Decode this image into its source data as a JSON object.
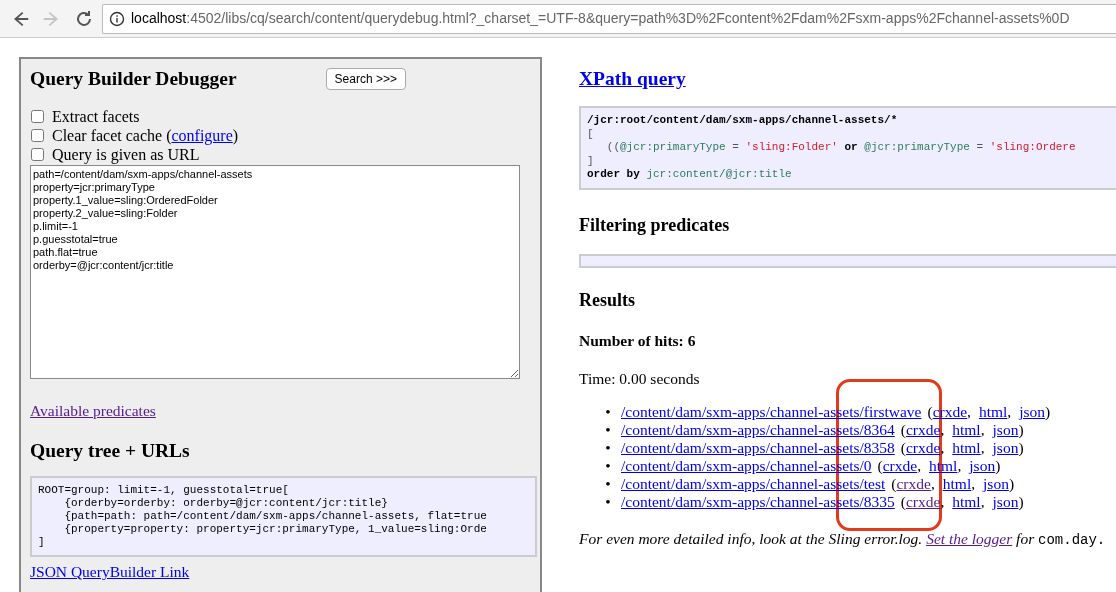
{
  "browser": {
    "back": {
      "disabled": false
    },
    "forward": {
      "disabled": true
    },
    "url_host": "localhost",
    "url_rest": ":4502/libs/cq/search/content/querydebug.html?_charset_=UTF-8&query=path%3D%2Fcontent%2Fdam%2Fsxm-apps%2Fchannel-assets%0D"
  },
  "left_panel": {
    "title": "Query Builder Debugger",
    "search_button": "Search >>>",
    "options": [
      {
        "label": "Extract facets",
        "checked": false
      },
      {
        "label": "Clear facet cache (",
        "link": "configure",
        "after": ")",
        "checked": false
      },
      {
        "label": "Query is given as URL",
        "checked": false
      }
    ],
    "query_text": "path=/content/dam/sxm-apps/channel-assets\nproperty=jcr:primaryType\nproperty.1_value=sling:OrderedFolder\nproperty.2_value=sling:Folder\np.limit=-1\np.guesstotal=true\npath.flat=true\norderby=@jcr:content/jcr:title",
    "predicates_link": {
      "text": "Available predicates",
      "visited": true
    },
    "tree_title": "Query tree + URLs",
    "tree_lines": [
      "ROOT=group: limit=-1, guesstotal=true[",
      "    {orderby=orderby: orderby=@jcr:content/jcr:title}",
      "    {path=path: path=/content/dam/sxm-apps/channel-assets, flat=true",
      "    {property=property: property=jcr:primaryType, 1_value=sling:Orde",
      "]"
    ],
    "json_link": {
      "text": "JSON QueryBuilder Link",
      "visited": false
    }
  },
  "right": {
    "xpath_title": "XPath query",
    "xpath_lines": [
      [
        {
          "kind": "keyword",
          "text": "/jcr:root/content/dam/sxm-apps/channel-assets/*"
        }
      ],
      [
        {
          "kind": "punct",
          "text": "["
        }
      ],
      [
        {
          "kind": "punct",
          "text": "   (("
        },
        {
          "kind": "attr",
          "text": "@jcr:primaryType"
        },
        {
          "kind": "punct",
          "text": " = "
        },
        {
          "kind": "string",
          "text": "'sling:Folder'"
        },
        {
          "kind": "keyword",
          "text": " or "
        },
        {
          "kind": "attr",
          "text": "@jcr:primaryType"
        },
        {
          "kind": "punct",
          "text": " = "
        },
        {
          "kind": "string",
          "text": "'sling:Ordere"
        }
      ],
      [
        {
          "kind": "punct",
          "text": "]"
        }
      ],
      [
        {
          "kind": "keyword",
          "text": "order by"
        },
        {
          "kind": "attr",
          "text": " jcr:content/@jcr:title"
        }
      ]
    ],
    "filter_title": "Filtering predicates",
    "results_title": "Results",
    "hits": "Number of hits: 6",
    "time": "Time: 0.00 seconds",
    "bullet": "•",
    "open_paren": "(",
    "separator": ",",
    "close_paren": ")",
    "results": [
      {
        "path": "/content/dam/sxm-apps/channel-assets/firstwave",
        "links": [
          {
            "text": "crxde",
            "visited": false
          },
          {
            "text": "html",
            "visited": false
          },
          {
            "text": "json",
            "visited": false
          }
        ]
      },
      {
        "path": "/content/dam/sxm-apps/channel-assets/8364",
        "links": [
          {
            "text": "crxde",
            "visited": false
          },
          {
            "text": "html",
            "visited": false
          },
          {
            "text": "json",
            "visited": false
          }
        ]
      },
      {
        "path": "/content/dam/sxm-apps/channel-assets/8358",
        "links": [
          {
            "text": "crxde",
            "visited": false
          },
          {
            "text": "html",
            "visited": false
          },
          {
            "text": "json",
            "visited": false
          }
        ]
      },
      {
        "path": "/content/dam/sxm-apps/channel-assets/0",
        "links": [
          {
            "text": "crxde",
            "visited": false
          },
          {
            "text": "html",
            "visited": false
          },
          {
            "text": "json",
            "visited": false
          }
        ]
      },
      {
        "path": "/content/dam/sxm-apps/channel-assets/test",
        "links": [
          {
            "text": "crxde",
            "visited": true
          },
          {
            "text": "html",
            "visited": false
          },
          {
            "text": "json",
            "visited": false
          }
        ]
      },
      {
        "path": "/content/dam/sxm-apps/channel-assets/8335",
        "links": [
          {
            "text": "crxde",
            "visited": true
          },
          {
            "text": "html",
            "visited": false
          },
          {
            "text": "json",
            "visited": false
          }
        ]
      }
    ],
    "footer": {
      "before": "For even more detailed info, look at the Sling error.log. ",
      "link": "Set the logger",
      "after": " for ",
      "code": "com.day."
    }
  },
  "annotations": [
    {
      "kind": "rounded-rect"
    }
  ]
}
